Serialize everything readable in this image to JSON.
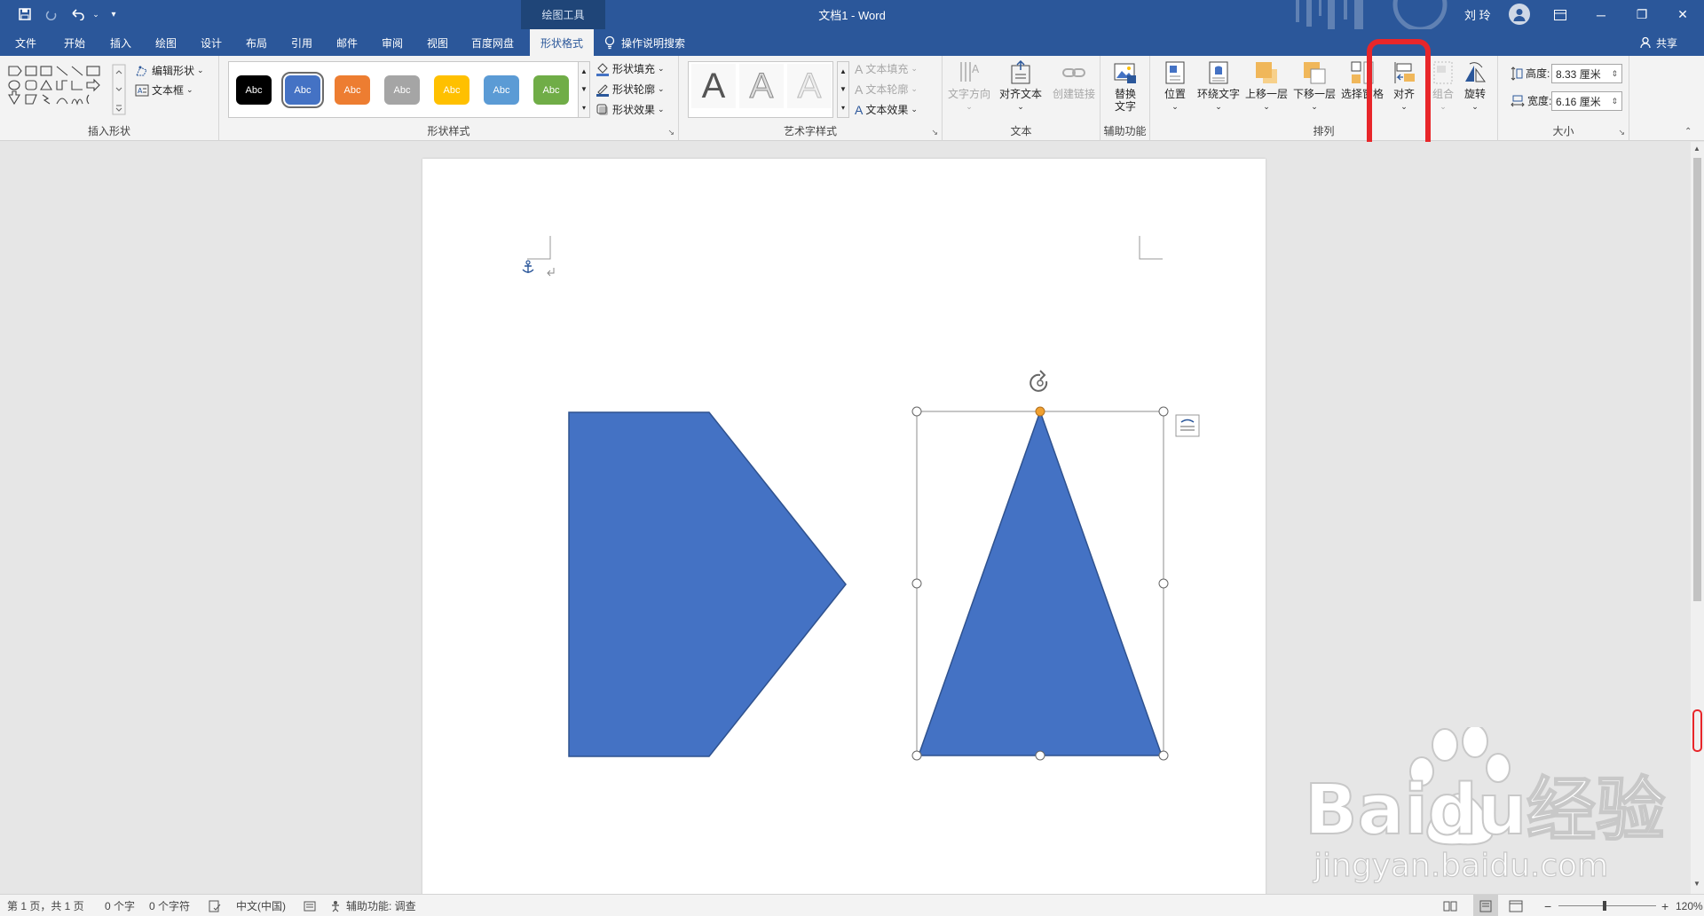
{
  "titlebar": {
    "tool_context": "绘图工具",
    "doc_title": "文档1  -  Word",
    "user_name": "刘 玲",
    "minimize": "─",
    "restore": "❐",
    "close": "✕"
  },
  "tabs": [
    {
      "label": "文件"
    },
    {
      "label": "开始"
    },
    {
      "label": "插入"
    },
    {
      "label": "绘图"
    },
    {
      "label": "设计"
    },
    {
      "label": "布局"
    },
    {
      "label": "引用"
    },
    {
      "label": "邮件"
    },
    {
      "label": "审阅"
    },
    {
      "label": "视图"
    },
    {
      "label": "百度网盘"
    },
    {
      "label": "形状格式",
      "active": true
    }
  ],
  "search_hint": "操作说明搜索",
  "share": "共享",
  "ribbon": {
    "insert_shapes": {
      "label": "插入形状",
      "edit_shape": "编辑形状",
      "text_box": "文本框"
    },
    "shape_styles": {
      "label": "形状样式",
      "swatches": [
        {
          "text": "Abc",
          "color": "#000000"
        },
        {
          "text": "Abc",
          "color": "#4472c4"
        },
        {
          "text": "Abc",
          "color": "#ed7d31"
        },
        {
          "text": "Abc",
          "color": "#a5a5a5"
        },
        {
          "text": "Abc",
          "color": "#ffc000"
        },
        {
          "text": "Abc",
          "color": "#5b9bd5"
        },
        {
          "text": "Abc",
          "color": "#70ad47"
        }
      ],
      "fill": "形状填充",
      "outline": "形状轮廓",
      "effects": "形状效果"
    },
    "wordart": {
      "label": "艺术字样式",
      "letter": "A",
      "text_fill": "文本填充",
      "text_outline": "文本轮廓",
      "text_effects": "文本效果"
    },
    "text": {
      "label": "文本",
      "direction": "文字方向",
      "align_text": "对齐文本",
      "create_link": "创建链接"
    },
    "accessibility": {
      "label": "辅助功能",
      "alt_text_1": "替换",
      "alt_text_2": "文字"
    },
    "arrange": {
      "label": "排列",
      "position": "位置",
      "wrap": "环绕文字",
      "bring_forward": "上移一层",
      "send_backward": "下移一层",
      "selection_pane": "选择窗格",
      "align": "对齐",
      "group": "组合",
      "rotate": "旋转"
    },
    "size": {
      "label": "大小",
      "height_label": "高度:",
      "height_value": "8.33 厘米",
      "width_label": "宽度:",
      "width_value": "6.16 厘米"
    }
  },
  "status": {
    "page": "第 1 页，共 1 页",
    "words": "0 个字",
    "chars": "0 个字符",
    "language": "中文(中国)",
    "accessibility": "辅助功能: 调查",
    "zoom": "120%"
  },
  "watermark": {
    "brand": "Baidu经验",
    "url": "jingyan.baidu.com"
  },
  "colors": {
    "word_blue": "#2b579a",
    "shape_fill": "#4472c4",
    "highlight_red": "#e8262a"
  }
}
